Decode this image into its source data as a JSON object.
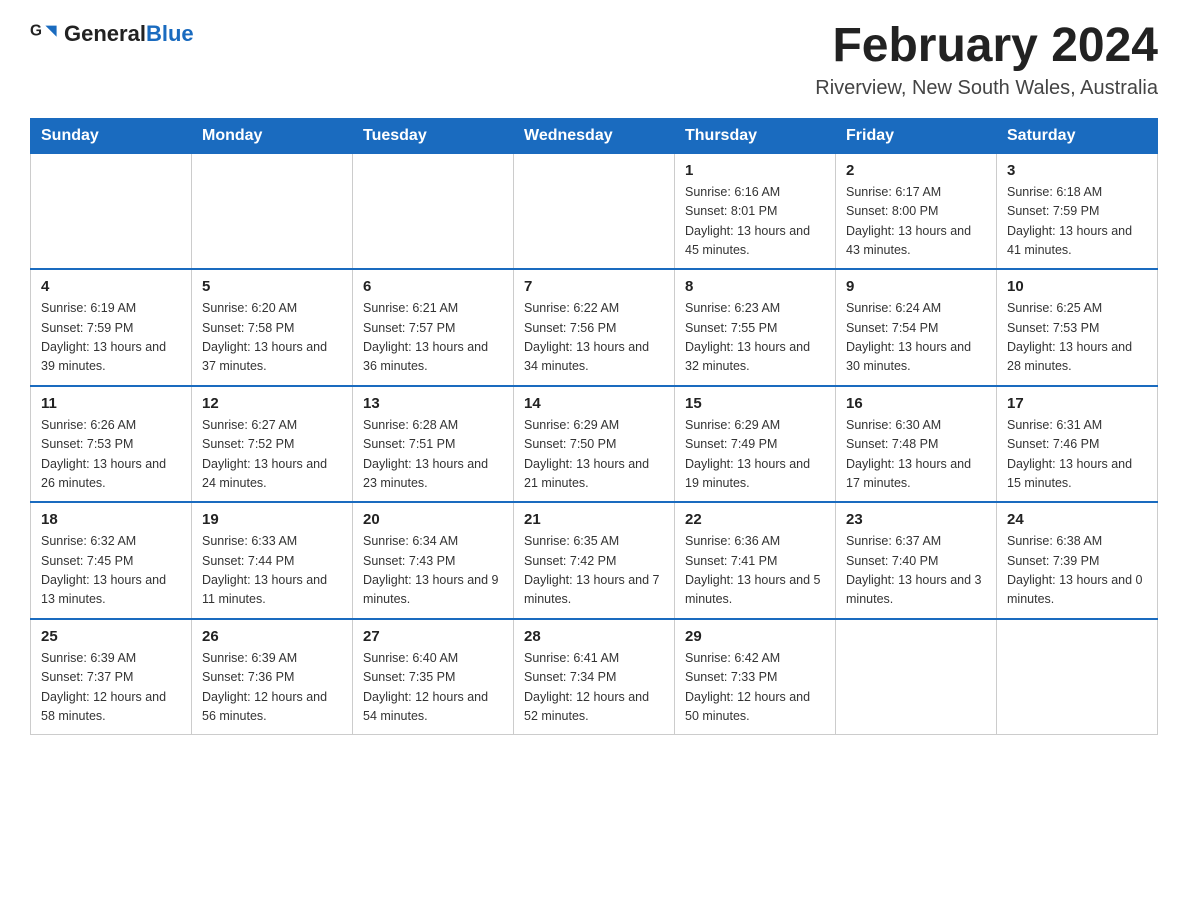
{
  "header": {
    "logo_general": "General",
    "logo_blue": "Blue",
    "title": "February 2024",
    "subtitle": "Riverview, New South Wales, Australia"
  },
  "days_of_week": [
    "Sunday",
    "Monday",
    "Tuesday",
    "Wednesday",
    "Thursday",
    "Friday",
    "Saturday"
  ],
  "weeks": [
    {
      "days": [
        {
          "num": "",
          "info": ""
        },
        {
          "num": "",
          "info": ""
        },
        {
          "num": "",
          "info": ""
        },
        {
          "num": "",
          "info": ""
        },
        {
          "num": "1",
          "info": "Sunrise: 6:16 AM\nSunset: 8:01 PM\nDaylight: 13 hours and 45 minutes."
        },
        {
          "num": "2",
          "info": "Sunrise: 6:17 AM\nSunset: 8:00 PM\nDaylight: 13 hours and 43 minutes."
        },
        {
          "num": "3",
          "info": "Sunrise: 6:18 AM\nSunset: 7:59 PM\nDaylight: 13 hours and 41 minutes."
        }
      ]
    },
    {
      "days": [
        {
          "num": "4",
          "info": "Sunrise: 6:19 AM\nSunset: 7:59 PM\nDaylight: 13 hours and 39 minutes."
        },
        {
          "num": "5",
          "info": "Sunrise: 6:20 AM\nSunset: 7:58 PM\nDaylight: 13 hours and 37 minutes."
        },
        {
          "num": "6",
          "info": "Sunrise: 6:21 AM\nSunset: 7:57 PM\nDaylight: 13 hours and 36 minutes."
        },
        {
          "num": "7",
          "info": "Sunrise: 6:22 AM\nSunset: 7:56 PM\nDaylight: 13 hours and 34 minutes."
        },
        {
          "num": "8",
          "info": "Sunrise: 6:23 AM\nSunset: 7:55 PM\nDaylight: 13 hours and 32 minutes."
        },
        {
          "num": "9",
          "info": "Sunrise: 6:24 AM\nSunset: 7:54 PM\nDaylight: 13 hours and 30 minutes."
        },
        {
          "num": "10",
          "info": "Sunrise: 6:25 AM\nSunset: 7:53 PM\nDaylight: 13 hours and 28 minutes."
        }
      ]
    },
    {
      "days": [
        {
          "num": "11",
          "info": "Sunrise: 6:26 AM\nSunset: 7:53 PM\nDaylight: 13 hours and 26 minutes."
        },
        {
          "num": "12",
          "info": "Sunrise: 6:27 AM\nSunset: 7:52 PM\nDaylight: 13 hours and 24 minutes."
        },
        {
          "num": "13",
          "info": "Sunrise: 6:28 AM\nSunset: 7:51 PM\nDaylight: 13 hours and 23 minutes."
        },
        {
          "num": "14",
          "info": "Sunrise: 6:29 AM\nSunset: 7:50 PM\nDaylight: 13 hours and 21 minutes."
        },
        {
          "num": "15",
          "info": "Sunrise: 6:29 AM\nSunset: 7:49 PM\nDaylight: 13 hours and 19 minutes."
        },
        {
          "num": "16",
          "info": "Sunrise: 6:30 AM\nSunset: 7:48 PM\nDaylight: 13 hours and 17 minutes."
        },
        {
          "num": "17",
          "info": "Sunrise: 6:31 AM\nSunset: 7:46 PM\nDaylight: 13 hours and 15 minutes."
        }
      ]
    },
    {
      "days": [
        {
          "num": "18",
          "info": "Sunrise: 6:32 AM\nSunset: 7:45 PM\nDaylight: 13 hours and 13 minutes."
        },
        {
          "num": "19",
          "info": "Sunrise: 6:33 AM\nSunset: 7:44 PM\nDaylight: 13 hours and 11 minutes."
        },
        {
          "num": "20",
          "info": "Sunrise: 6:34 AM\nSunset: 7:43 PM\nDaylight: 13 hours and 9 minutes."
        },
        {
          "num": "21",
          "info": "Sunrise: 6:35 AM\nSunset: 7:42 PM\nDaylight: 13 hours and 7 minutes."
        },
        {
          "num": "22",
          "info": "Sunrise: 6:36 AM\nSunset: 7:41 PM\nDaylight: 13 hours and 5 minutes."
        },
        {
          "num": "23",
          "info": "Sunrise: 6:37 AM\nSunset: 7:40 PM\nDaylight: 13 hours and 3 minutes."
        },
        {
          "num": "24",
          "info": "Sunrise: 6:38 AM\nSunset: 7:39 PM\nDaylight: 13 hours and 0 minutes."
        }
      ]
    },
    {
      "days": [
        {
          "num": "25",
          "info": "Sunrise: 6:39 AM\nSunset: 7:37 PM\nDaylight: 12 hours and 58 minutes."
        },
        {
          "num": "26",
          "info": "Sunrise: 6:39 AM\nSunset: 7:36 PM\nDaylight: 12 hours and 56 minutes."
        },
        {
          "num": "27",
          "info": "Sunrise: 6:40 AM\nSunset: 7:35 PM\nDaylight: 12 hours and 54 minutes."
        },
        {
          "num": "28",
          "info": "Sunrise: 6:41 AM\nSunset: 7:34 PM\nDaylight: 12 hours and 52 minutes."
        },
        {
          "num": "29",
          "info": "Sunrise: 6:42 AM\nSunset: 7:33 PM\nDaylight: 12 hours and 50 minutes."
        },
        {
          "num": "",
          "info": ""
        },
        {
          "num": "",
          "info": ""
        }
      ]
    }
  ]
}
